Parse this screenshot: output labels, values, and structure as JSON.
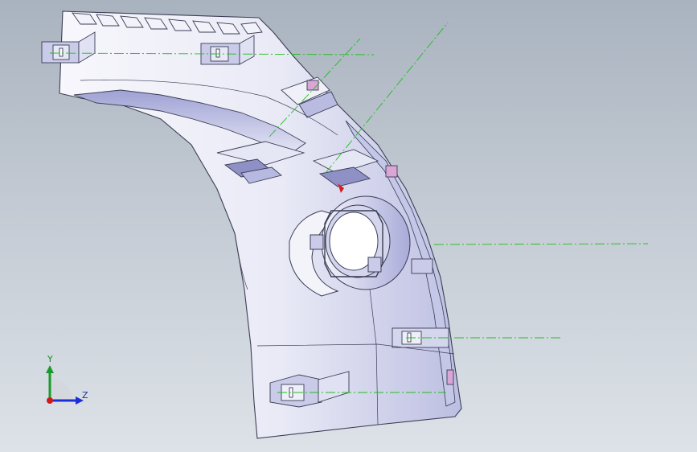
{
  "viewport": {
    "background_top": "#a9b3bf",
    "background_bottom": "#dde2e8"
  },
  "model": {
    "description_name": "part-model",
    "colors": {
      "body_fill": "#ecedf7",
      "body_edge": "#3b3d55",
      "shade_fill": "#b9bce0",
      "highlight_fill": "#ffffff",
      "accent_pink": "#d9a6d6",
      "accent_red": "#d02020",
      "centerline": "#1fbf1f"
    }
  },
  "triad": {
    "y_label": "Y",
    "z_label": "Z",
    "y_color": "#1a9a2a",
    "z_color": "#1b2fd8",
    "x_color": "#d01a1a"
  }
}
